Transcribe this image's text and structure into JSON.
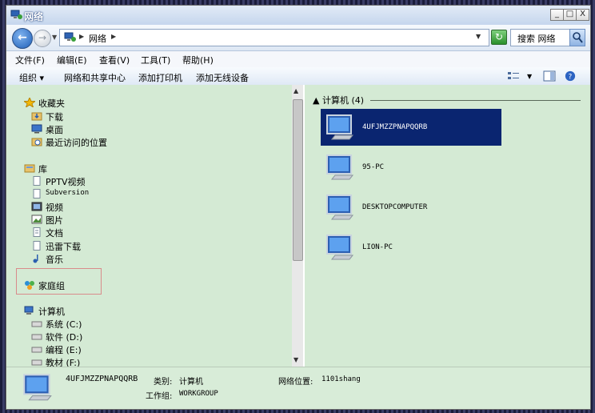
{
  "window": {
    "title": "网络",
    "controls": {
      "minimize": "_",
      "maximize": "□",
      "close": "X"
    }
  },
  "nav": {
    "back_glyph": "←",
    "forward_glyph": "→",
    "address_segments": [
      "网络"
    ],
    "search_placeholder": "搜索 网络"
  },
  "menu": {
    "items": [
      "文件(F)",
      "编辑(E)",
      "查看(V)",
      "工具(T)",
      "帮助(H)"
    ]
  },
  "toolbar": {
    "organize": "组织",
    "network_sharing": "网络和共享中心",
    "add_printer": "添加打印机",
    "add_wireless": "添加无线设备"
  },
  "sidebar": {
    "favorites": {
      "label": "收藏夹",
      "items": [
        "下载",
        "桌面",
        "最近访问的位置"
      ]
    },
    "libraries": {
      "label": "库",
      "items": [
        "PPTV视频",
        "Subversion",
        "视频",
        "图片",
        "文档",
        "迅雷下载",
        "音乐"
      ]
    },
    "homegroup": {
      "label": "家庭组"
    },
    "computer": {
      "label": "计算机",
      "items": [
        "系统 (C:)",
        "软件 (D:)",
        "编程 (E:)",
        "教材 (F:)"
      ]
    }
  },
  "content": {
    "group_label": "计算机 (4)",
    "computers": [
      {
        "name": "4UFJMZZPNAPQQRB",
        "selected": true
      },
      {
        "name": "95-PC",
        "selected": false
      },
      {
        "name": "DESKTOPCOMPUTER",
        "selected": false
      },
      {
        "name": "LION-PC",
        "selected": false
      }
    ]
  },
  "details": {
    "name": "4UFJMZZPNAPQQRB",
    "category_label": "类别:",
    "category_value": "计算机",
    "location_label": "网络位置:",
    "location_value": "1101shang",
    "workgroup_label": "工作组:",
    "workgroup_value": "WORKGROUP"
  },
  "colors": {
    "pane_bg": "#d4ead4",
    "selected_bg": "#0a2570",
    "homegroup_box": "#d98b8b"
  }
}
